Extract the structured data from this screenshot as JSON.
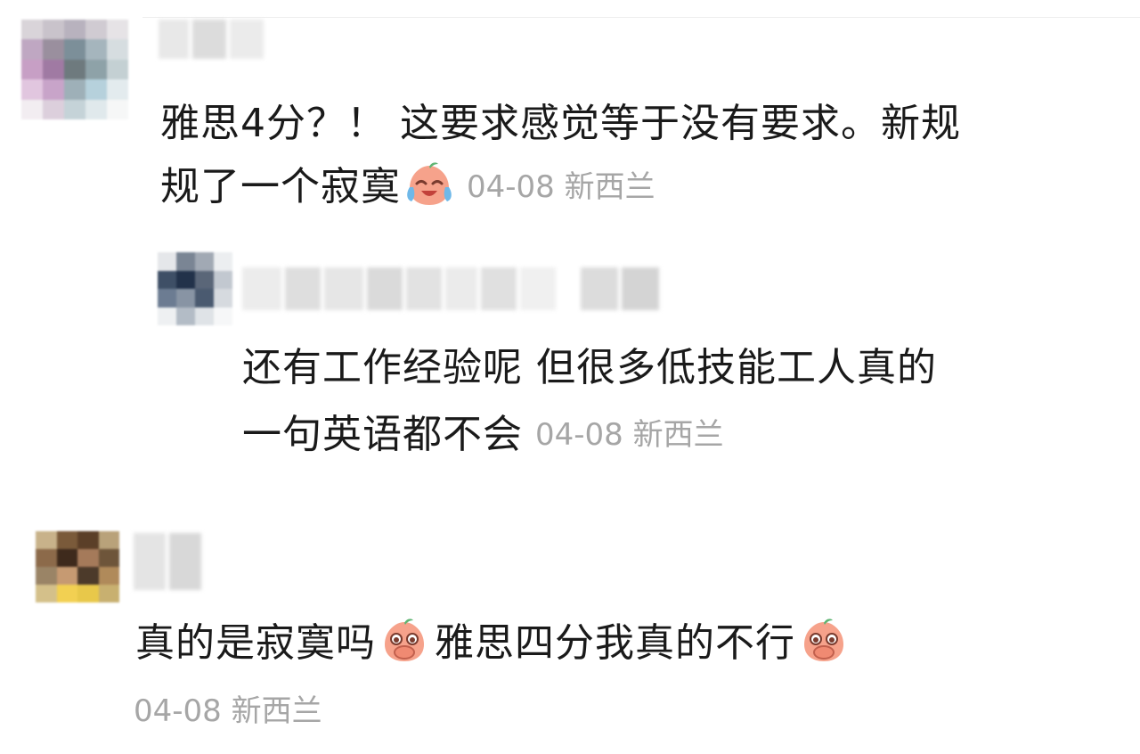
{
  "comments": [
    {
      "text_line1": "雅思4分？！ 这要求感觉等于没有要求。新规",
      "text_line2": "规了一个寂寞",
      "emoji": "crying-laughing-peach-emoji",
      "meta": "04-08 新西兰"
    },
    {
      "text_line1": "还有工作经验呢 但很多低技能工人真的",
      "text_line2": "一句英语都不会",
      "meta": "04-08 新西兰"
    },
    {
      "text_part1": "真的是寂寞吗",
      "emoji_1": "covering-mouth-peach-emoji",
      "text_part2": "雅思四分我真的不行",
      "emoji_2": "covering-mouth-peach-emoji",
      "meta": "04-08 新西兰"
    }
  ],
  "colors": {
    "text": "#1a1a1a",
    "meta": "#a6a6a6",
    "emoji_face": "#f6a28b"
  }
}
